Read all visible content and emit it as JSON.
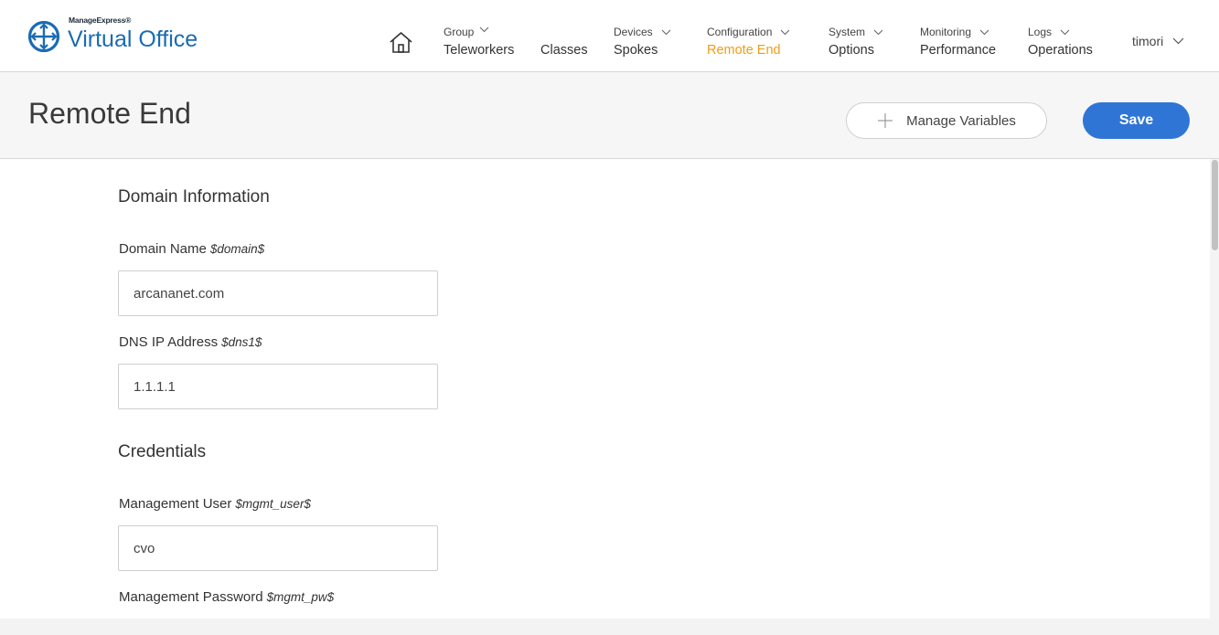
{
  "brand": {
    "small": "ManageExpress®",
    "name": "Virtual Office",
    "color": "#1b6bb3"
  },
  "nav": {
    "home_icon": "home-icon",
    "items": [
      {
        "top": "Group",
        "main": "Teleworkers"
      },
      {
        "main": "Classes"
      },
      {
        "top": "Devices",
        "main": "Spokes"
      },
      {
        "top": "Configuration",
        "main": "Remote End",
        "active": true
      },
      {
        "top": "System",
        "main": "Options"
      },
      {
        "top": "Monitoring",
        "main": "Performance"
      },
      {
        "top": "Logs",
        "main": "Operations"
      }
    ],
    "user": "timori",
    "active_color": "#f29c12"
  },
  "page": {
    "title": "Remote End",
    "manage_variables_label": "Manage Variables",
    "save_label": "Save",
    "save_color": "#2f75d6"
  },
  "sections": {
    "domain": {
      "title": "Domain Information",
      "fields": [
        {
          "label": "Domain Name",
          "var": "$domain$",
          "value": "arcananet.com"
        },
        {
          "label": "DNS IP Address",
          "var": "$dns1$",
          "value": "1.1.1.1"
        }
      ]
    },
    "credentials": {
      "title": "Credentials",
      "fields": [
        {
          "label": "Management User",
          "var": "$mgmt_user$",
          "value": "cvo"
        },
        {
          "label": "Management Password",
          "var": "$mgmt_pw$"
        }
      ]
    }
  }
}
